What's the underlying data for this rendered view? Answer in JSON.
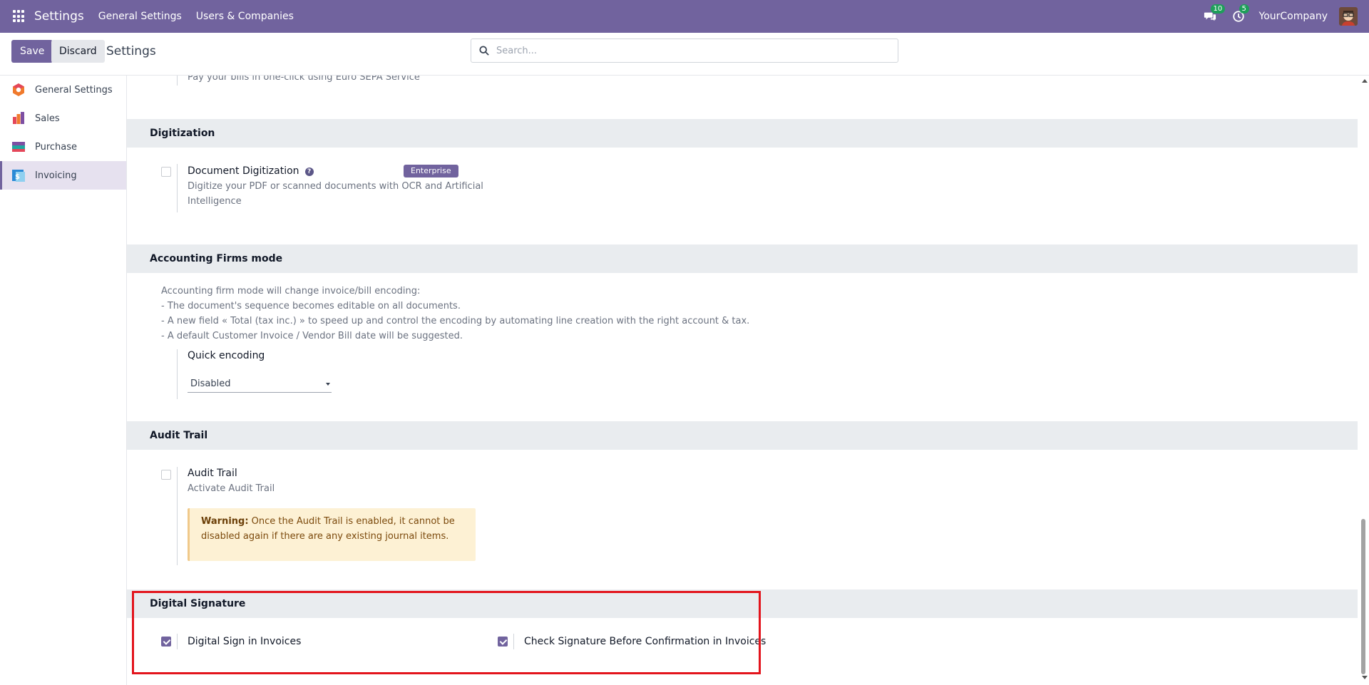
{
  "navbar": {
    "brand": "Settings",
    "menu": [
      "General Settings",
      "Users & Companies"
    ],
    "messages_count": "10",
    "activities_count": "5",
    "company": "YourCompany"
  },
  "control": {
    "save_label": "Save",
    "discard_label": "Discard",
    "title": "Settings",
    "search_placeholder": "Search..."
  },
  "sidebar": {
    "items": [
      {
        "label": "General Settings",
        "icon": "general-settings-app-icon"
      },
      {
        "label": "Sales",
        "icon": "sales-app-icon"
      },
      {
        "label": "Purchase",
        "icon": "purchase-app-icon"
      },
      {
        "label": "Invoicing",
        "icon": "invoicing-app-icon",
        "active": true
      }
    ]
  },
  "content": {
    "sepa_desc": "Pay your bills in one-click using Euro SEPA Service",
    "digitization": {
      "heading": "Digitization",
      "title": "Document Digitization",
      "badge": "Enterprise",
      "desc_line1": "Digitize your PDF or scanned documents with OCR and Artificial",
      "desc_line2": "Intelligence",
      "checked": false
    },
    "firms": {
      "heading": "Accounting Firms mode",
      "lines": [
        "Accounting firm mode will change invoice/bill encoding:",
        "- The document's sequence becomes editable on all documents.",
        "- A new field « Total (tax inc.) » to speed up and control the encoding by automating line creation with the right account & tax.",
        "- A default Customer Invoice / Vendor Bill date will be suggested."
      ],
      "quick_label": "Quick encoding",
      "quick_value": "Disabled"
    },
    "audit": {
      "heading": "Audit Trail",
      "title": "Audit Trail",
      "desc": "Activate Audit Trail",
      "warning_strong": "Warning:",
      "warning_text1": " Once the Audit Trail is enabled, it cannot be",
      "warning_text2": "disabled again if there are any existing journal items.",
      "checked": false
    },
    "signature": {
      "heading": "Digital Signature",
      "option1": "Digital Sign in Invoices",
      "option2": "Check Signature Before Confirmation in Invoices",
      "option1_checked": true,
      "option2_checked": true
    }
  },
  "colors": {
    "brand": "#71639e",
    "highlight": "#e3141c",
    "section_bg": "#e9ecef",
    "warning_bg": "#fdf1d4"
  }
}
